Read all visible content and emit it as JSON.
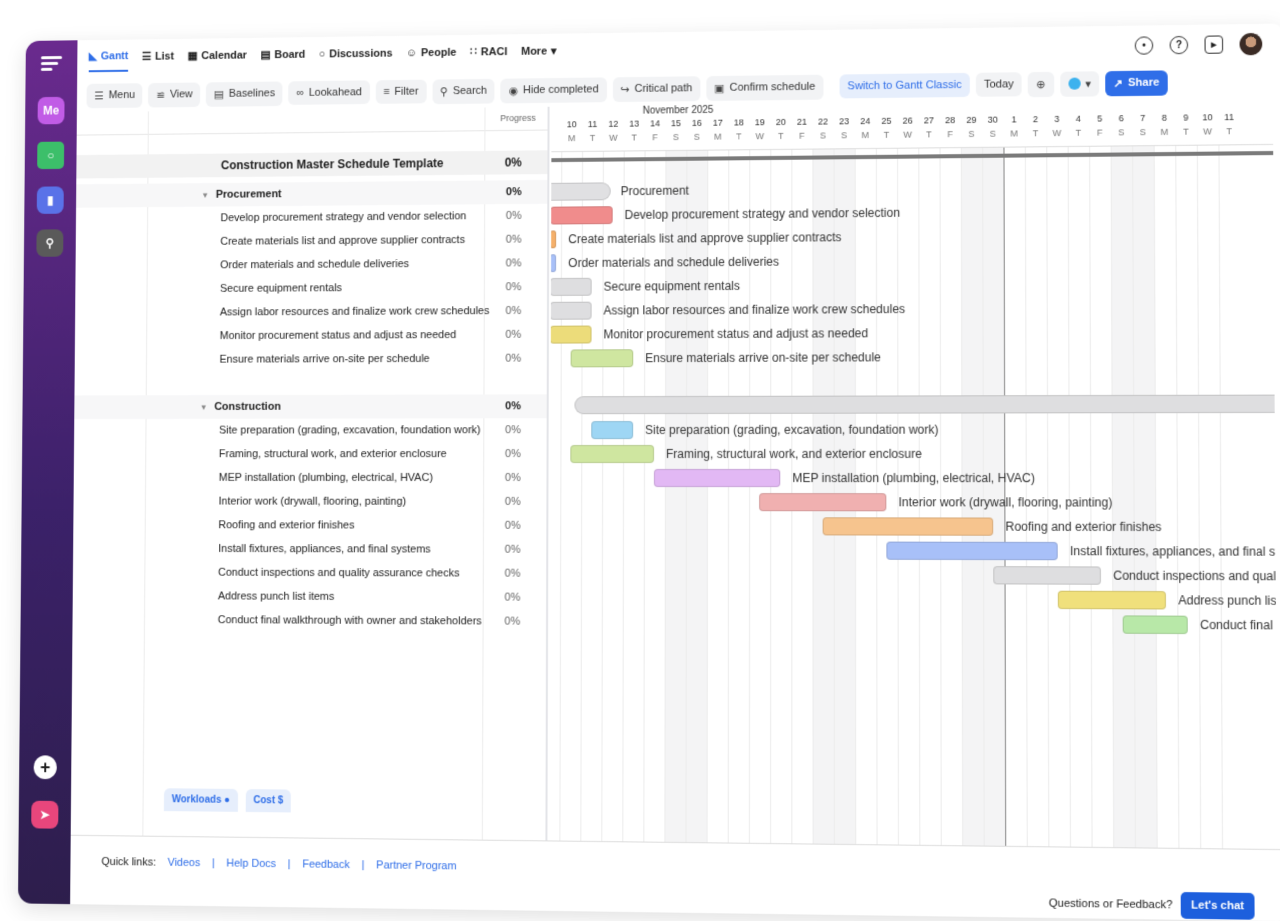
{
  "nav_tabs": [
    {
      "icon": "gantt-icon",
      "label": "Gantt",
      "active": true
    },
    {
      "icon": "list-icon",
      "label": "List"
    },
    {
      "icon": "calendar-icon",
      "label": "Calendar"
    },
    {
      "icon": "board-icon",
      "label": "Board"
    },
    {
      "icon": "discussions-icon",
      "label": "Discussions"
    },
    {
      "icon": "people-icon",
      "label": "People"
    },
    {
      "icon": "raci-icon",
      "label": "RACI"
    },
    {
      "icon": "chevron-down-icon",
      "label": "More"
    }
  ],
  "sidebar": {
    "me_label": "Me"
  },
  "toolbar": {
    "menu": "Menu",
    "view": "View",
    "baselines": "Baselines",
    "lookahead": "Lookahead",
    "filter": "Filter",
    "search": "Search",
    "hide_completed": "Hide completed",
    "critical_path": "Critical path",
    "confirm_schedule": "Confirm schedule",
    "switch_classic": "Switch to Gantt Classic",
    "today": "Today",
    "share": "Share",
    "accent": "#2f6ee8"
  },
  "grid": {
    "progress_header": "Progress",
    "title": {
      "name": "Construction Master Schedule Template",
      "pct": "0%"
    },
    "groups": [
      {
        "name": "Procurement",
        "pct": "0%",
        "tasks": [
          {
            "name": "Develop procurement strategy and vendor selection",
            "pct": "0%"
          },
          {
            "name": "Create materials list and approve supplier contracts",
            "pct": "0%"
          },
          {
            "name": "Order materials and schedule deliveries",
            "pct": "0%"
          },
          {
            "name": "Secure equipment rentals",
            "pct": "0%"
          },
          {
            "name": "Assign labor resources and finalize work crew schedules",
            "pct": "0%"
          },
          {
            "name": "Monitor procurement status and adjust as needed",
            "pct": "0%"
          },
          {
            "name": "Ensure materials arrive on-site per schedule",
            "pct": "0%"
          }
        ]
      },
      {
        "name": "Construction",
        "pct": "0%",
        "tasks": [
          {
            "name": "Site preparation (grading, excavation, foundation work)",
            "pct": "0%"
          },
          {
            "name": "Framing, structural work, and exterior enclosure",
            "pct": "0%"
          },
          {
            "name": "MEP installation (plumbing, electrical, HVAC)",
            "pct": "0%"
          },
          {
            "name": "Interior work (drywall, flooring, painting)",
            "pct": "0%"
          },
          {
            "name": "Roofing and exterior finishes",
            "pct": "0%"
          },
          {
            "name": "Install fixtures, appliances, and final systems",
            "pct": "0%"
          },
          {
            "name": "Conduct inspections and quality assurance checks",
            "pct": "0%"
          },
          {
            "name": "Address punch list items",
            "pct": "0%"
          },
          {
            "name": "Conduct final walkthrough with owner and stakeholders",
            "pct": "0%"
          }
        ]
      }
    ]
  },
  "gantt": {
    "month": "November 2025",
    "days": [
      {
        "d": "10",
        "w": "M"
      },
      {
        "d": "11",
        "w": "T"
      },
      {
        "d": "12",
        "w": "W"
      },
      {
        "d": "13",
        "w": "T"
      },
      {
        "d": "14",
        "w": "F"
      },
      {
        "d": "15",
        "w": "S"
      },
      {
        "d": "16",
        "w": "S"
      },
      {
        "d": "17",
        "w": "M"
      },
      {
        "d": "18",
        "w": "T"
      },
      {
        "d": "19",
        "w": "W"
      },
      {
        "d": "20",
        "w": "T"
      },
      {
        "d": "21",
        "w": "F"
      },
      {
        "d": "22",
        "w": "S"
      },
      {
        "d": "23",
        "w": "S"
      },
      {
        "d": "24",
        "w": "M"
      },
      {
        "d": "25",
        "w": "T"
      },
      {
        "d": "26",
        "w": "W"
      },
      {
        "d": "27",
        "w": "T"
      },
      {
        "d": "28",
        "w": "F"
      },
      {
        "d": "29",
        "w": "S"
      },
      {
        "d": "30",
        "w": "S"
      },
      {
        "d": "1",
        "w": "M"
      },
      {
        "d": "2",
        "w": "T"
      },
      {
        "d": "3",
        "w": "W"
      },
      {
        "d": "4",
        "w": "T"
      },
      {
        "d": "5",
        "w": "F"
      },
      {
        "d": "6",
        "w": "S"
      },
      {
        "d": "7",
        "w": "S"
      },
      {
        "d": "8",
        "w": "M"
      },
      {
        "d": "9",
        "w": "T"
      },
      {
        "d": "10",
        "w": "W"
      },
      {
        "d": "11",
        "w": "T"
      }
    ],
    "bar_colors": [
      "#d9d9dc",
      "#f08c8c",
      "#f5b06a",
      "#a8c0f8",
      "#dedee0",
      "#dedee0",
      "#ecdc7a",
      "#cfe6a0",
      "#9ed6f4",
      "#cfe6a0",
      "#e2b8f4",
      "#f0b0b0",
      "#f6c48e",
      "#a8c0f8",
      "#dedee0",
      "#f0e07c",
      "#b8e8a8"
    ]
  },
  "bottom_tabs": {
    "workloads": "Workloads",
    "cost": "Cost"
  },
  "footer": {
    "quick_links_label": "Quick links:",
    "links": [
      "Videos",
      "Help Docs",
      "Feedback",
      "Partner Program"
    ],
    "questions": "Questions or Feedback?",
    "chat": "Let's chat"
  }
}
